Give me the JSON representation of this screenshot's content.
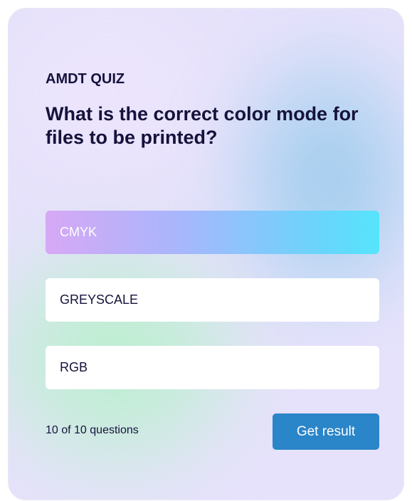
{
  "quiz": {
    "label": "AMDT QUIZ",
    "question": "What is the correct color mode for files to be printed?",
    "options": [
      {
        "label": "CMYK",
        "selected": true
      },
      {
        "label": "GREYSCALE",
        "selected": false
      },
      {
        "label": "RGB",
        "selected": false
      }
    ],
    "progress": "10 of 10 questions",
    "result_button": "Get result"
  },
  "colors": {
    "text": "#15133c",
    "button": "#2a85c9",
    "selected_gradient_start": "#d7a8f6",
    "selected_gradient_end": "#55e4fb"
  }
}
